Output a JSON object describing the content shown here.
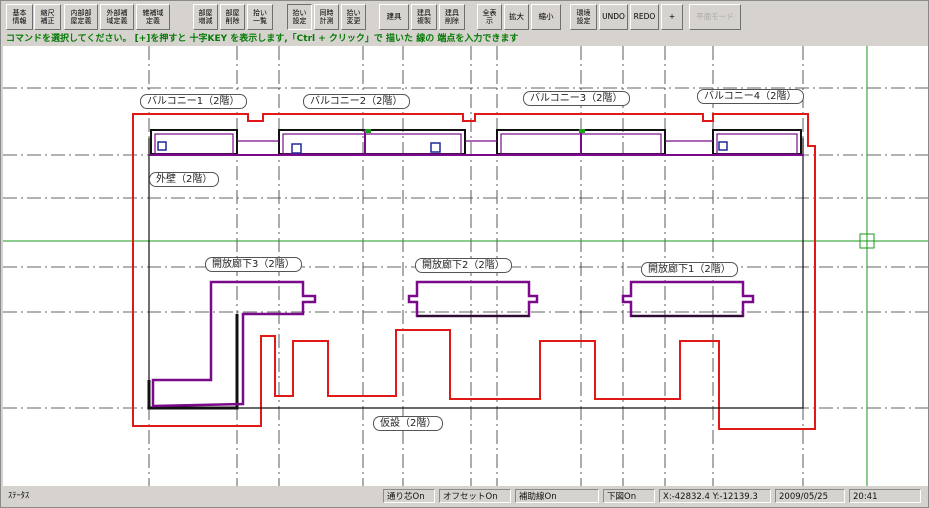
{
  "toolbar": {
    "buttons": [
      {
        "label": "基本\n情報"
      },
      {
        "label": "縮尺\n補正"
      },
      {
        "label": "内部部\n屋定義"
      },
      {
        "label": "外部補\n域定義"
      },
      {
        "label": "雑補域\n定義"
      },
      {
        "label": "部屋\n増減"
      },
      {
        "label": "部屋\n削除"
      },
      {
        "label": "拾い\n一覧"
      },
      {
        "label": "拾い\n設定"
      },
      {
        "label": "同時\n計測"
      },
      {
        "label": "拾い\n変更"
      },
      {
        "label": "建具"
      },
      {
        "label": "建具\n複製"
      },
      {
        "label": "建具\n削除"
      },
      {
        "label": "全表\n示"
      },
      {
        "label": "拡大"
      },
      {
        "label": "縮小"
      },
      {
        "label": "環境\n設定"
      },
      {
        "label": "UNDO"
      },
      {
        "label": "REDO"
      },
      {
        "label": "+"
      },
      {
        "label": "平面モード"
      }
    ]
  },
  "command_message": "コマンドを選択してください。 [+]を押すと 十字KEY を表示します,「Ctrl + クリック」で 描いた 線の 端点を入力できます",
  "drawing": {
    "labels": {
      "balcony1": "バルコニー1（2階）",
      "balcony2": "バルコニー2（2階）",
      "balcony3": "バルコニー3（2階）",
      "balcony4": "バルコニー4（2階）",
      "outer_wall": "外壁（2階）",
      "corridor3": "開放廊下3（2階）",
      "corridor2": "開放廊下2（2階）",
      "corridor1": "開放廊下1（2階）",
      "temporary": "仮設（2階）"
    },
    "colors": {
      "temporary_outline": "#e01818",
      "corridor_outline": "#7a0a8a",
      "wall_outline": "#111111",
      "grid_lines": "#333333",
      "crosshair": "#1a9a1a"
    }
  },
  "status": {
    "label": "ｽﾃｰﾀｽ",
    "grid_snap": "通り芯On",
    "offset": "オフセットOn",
    "aux_line": "補助線On",
    "underlay": "下図On",
    "coords": "X:-42832.4 Y:-12139.3",
    "date": "2009/05/25",
    "time": "20:41"
  }
}
